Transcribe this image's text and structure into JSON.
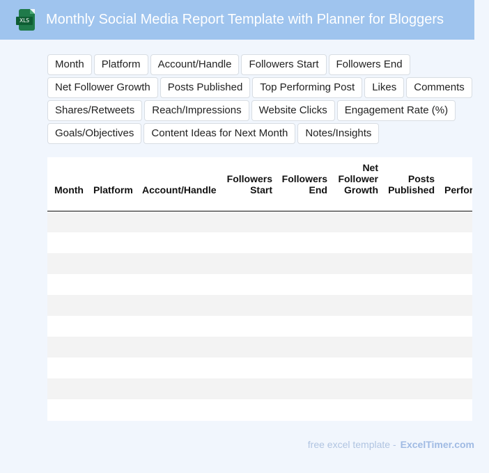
{
  "header": {
    "file_icon": "xls-file-icon",
    "file_tag": "XLS",
    "title": "Monthly Social Media Report Template with Planner for Bloggers"
  },
  "fields": [
    "Month",
    "Platform",
    "Account/Handle",
    "Followers Start",
    "Followers End",
    "Net Follower Growth",
    "Posts Published",
    "Top Performing Post",
    "Likes",
    "Comments",
    "Shares/Retweets",
    "Reach/Impressions",
    "Website Clicks",
    "Engagement Rate (%)",
    "Goals/Objectives",
    "Content Ideas for Next Month",
    "Notes/Insights"
  ],
  "table": {
    "headers": [
      {
        "lines": [
          "Month"
        ]
      },
      {
        "lines": [
          "Platform"
        ]
      },
      {
        "lines": [
          "Account/Handle"
        ]
      },
      {
        "lines": [
          "Followers",
          "Start"
        ]
      },
      {
        "lines": [
          "Followers",
          "End"
        ]
      },
      {
        "lines": [
          "Net",
          "Follower",
          "Growth"
        ]
      },
      {
        "lines": [
          "Posts",
          "Published"
        ]
      },
      {
        "lines": [
          "Perfor"
        ]
      }
    ],
    "empty_rows": 10
  },
  "footer": {
    "text": "free excel template -",
    "brand": "ExcelTimer.com"
  },
  "colors": {
    "header_bg": "#9fc4ee",
    "page_bg": "#f1f6fd",
    "stripe": "#f3f3f3",
    "footer_text": "#b0c4e1"
  }
}
